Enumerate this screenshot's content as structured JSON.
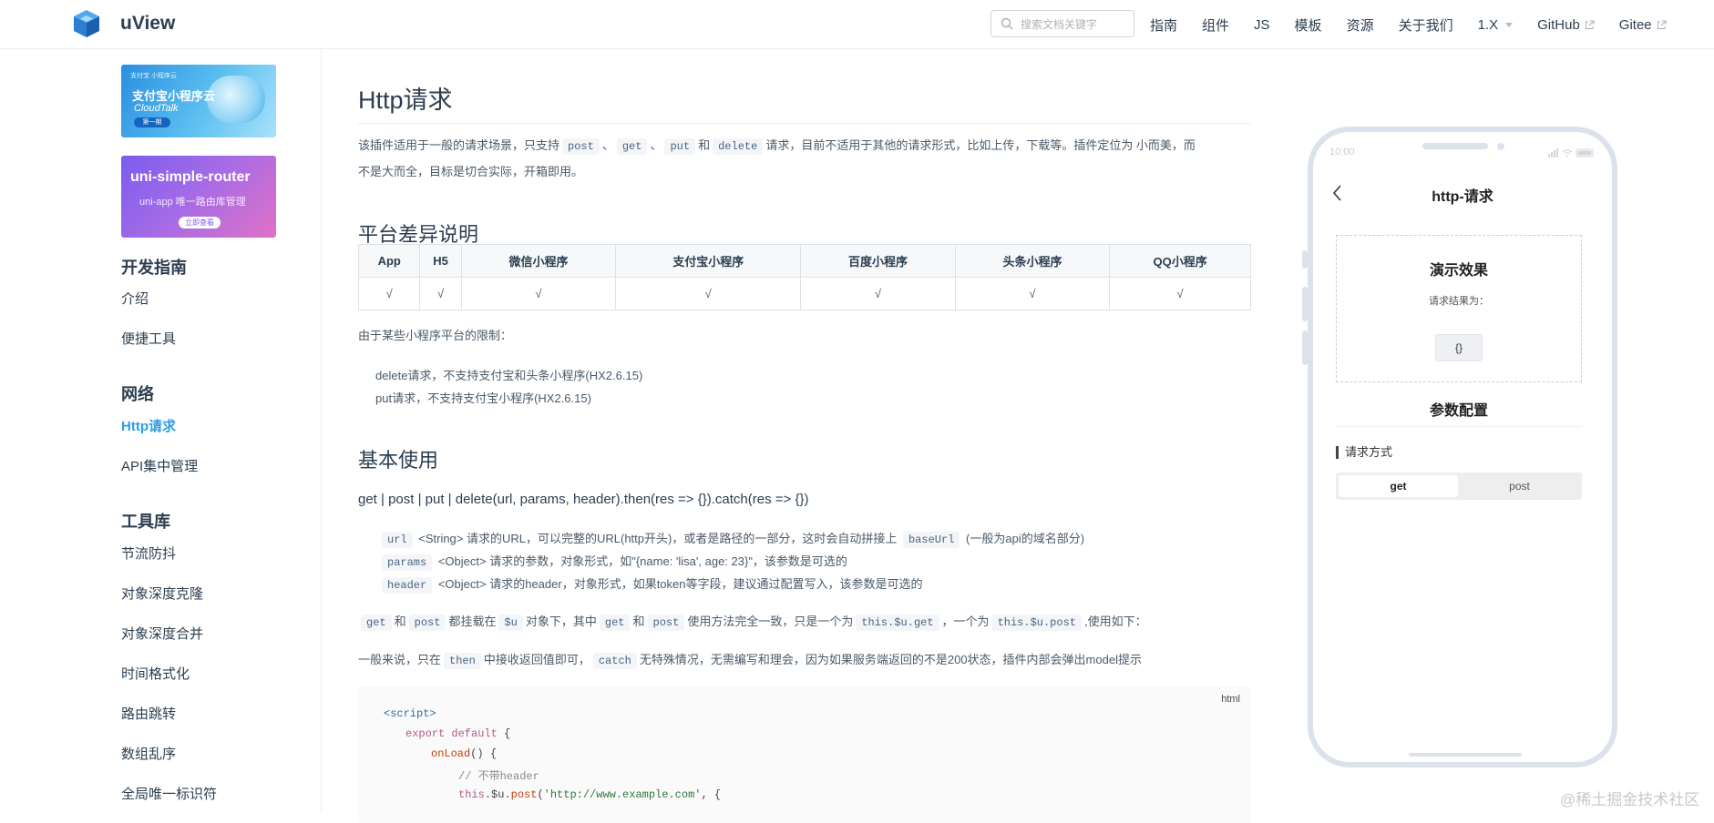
{
  "app": {
    "name": "uView"
  },
  "search": {
    "placeholder": "搜索文档关键字"
  },
  "nav": {
    "items": [
      "指南",
      "组件",
      "JS",
      "模板",
      "资源",
      "关于我们"
    ],
    "version": "1.X",
    "external": [
      "GitHub",
      "Gitee"
    ]
  },
  "banners": {
    "b1": {
      "small": "支付宝 小程序云",
      "title": "支付宝小程序云",
      "sub": "CloudTalk",
      "btn": "第一期"
    },
    "b2": {
      "title": "uni-simple-router",
      "sub": "uni-app 唯一路由库管理",
      "btn": "立即查看"
    }
  },
  "sidebar": {
    "groups": [
      {
        "title": "开发指南",
        "items": [
          "介绍",
          "便捷工具"
        ]
      },
      {
        "title": "网络",
        "items": [
          "Http请求",
          "API集中管理"
        ]
      },
      {
        "title": "工具库",
        "items": [
          "节流防抖",
          "对象深度克隆",
          "对象深度合并",
          "时间格式化",
          "路由跳转",
          "数组乱序",
          "全局唯一标识符"
        ]
      }
    ],
    "active": "Http请求"
  },
  "page": {
    "title": "Http请求",
    "intro": {
      "p1": "该插件适用于一般的请求场景，只支持",
      "c1": "post",
      "s1": "、",
      "c2": "get",
      "s2": "、",
      "c3": "put",
      "s3": "和",
      "c4": "delete",
      "p2": "请求，目前不适用于其他的请求形式，比如上传，下载等。插件定位为 小而美，而",
      "p3": "不是大而全，目标是切合实际，开箱即用。"
    },
    "h2_platform": "平台差异说明",
    "table": {
      "headers": [
        "App",
        "H5",
        "微信小程序",
        "支付宝小程序",
        "百度小程序",
        "头条小程序",
        "QQ小程序"
      ],
      "row": [
        "√",
        "√",
        "√",
        "√",
        "√",
        "√",
        "√"
      ]
    },
    "limit_intro": "由于某些小程序平台的限制：",
    "limits": [
      "delete请求，不支持支付宝和头条小程序(HX2.6.15)",
      "put请求，不支持支付宝小程序(HX2.6.15)"
    ],
    "h2_basic": "基本使用",
    "usage": "get | post | put | delete(url, params, header).then(res => {}).catch(res => {})",
    "params": [
      {
        "code": "url",
        "text": "<String> 请求的URL，可以完整的URL(http开头)，或者是路径的一部分，这时会自动拼接上",
        "code2": "baseUrl",
        "text2": "(一般为api的域名部分)"
      },
      {
        "code": "params",
        "text": "<Object> 请求的参数，对象形式，如\"{name: 'lisa', age: 23}\"，该参数是可选的"
      },
      {
        "code": "header",
        "text": "<Object> 请求的header，对象形式，如果token等字段，建议通过配置写入，该参数是可选的"
      }
    ],
    "mounted": {
      "c1": "get",
      "t1": "和",
      "c2": "post",
      "t2": "都挂载在",
      "c3": "$u",
      "t3": "对象下，其中",
      "c4": "get",
      "t4": "和",
      "c5": "post",
      "t5": "使用方法完全一致，只是一个为",
      "c6": "this.$u.get",
      "t6": "，一个为",
      "c7": "this.$u.post",
      "t7": ",使用如下："
    },
    "then_note": {
      "t1": "一般来说，只在",
      "c1": "then",
      "t2": "中接收返回值即可，",
      "c2": "catch",
      "t3": "无特殊情况，无需编写和理会，因为如果服务端返回的不是200状态，插件内部会弹出model提示"
    },
    "code": {
      "lang": "html",
      "l1": "<script>",
      "l2_kw": "export default",
      "l2_rest": " {",
      "l3_fn": "onLoad",
      "l3_rest": "() {",
      "l4": "// 不带header",
      "l5_a": "this",
      "l5_b": ".$u.",
      "l5_fn": "post",
      "l5_c": "(",
      "l5_str": "'http://www.example.com'",
      "l5_d": ", {"
    }
  },
  "phone": {
    "time": "10:00",
    "title": "http-请求",
    "demo_title": "演示效果",
    "demo_label": "请求结果为：",
    "demo_result": "{}",
    "cfg_title": "参数配置",
    "cfg_label": "请求方式",
    "options": [
      "get",
      "post"
    ],
    "selected": "get"
  },
  "watermark": "@稀土掘金技术社区"
}
